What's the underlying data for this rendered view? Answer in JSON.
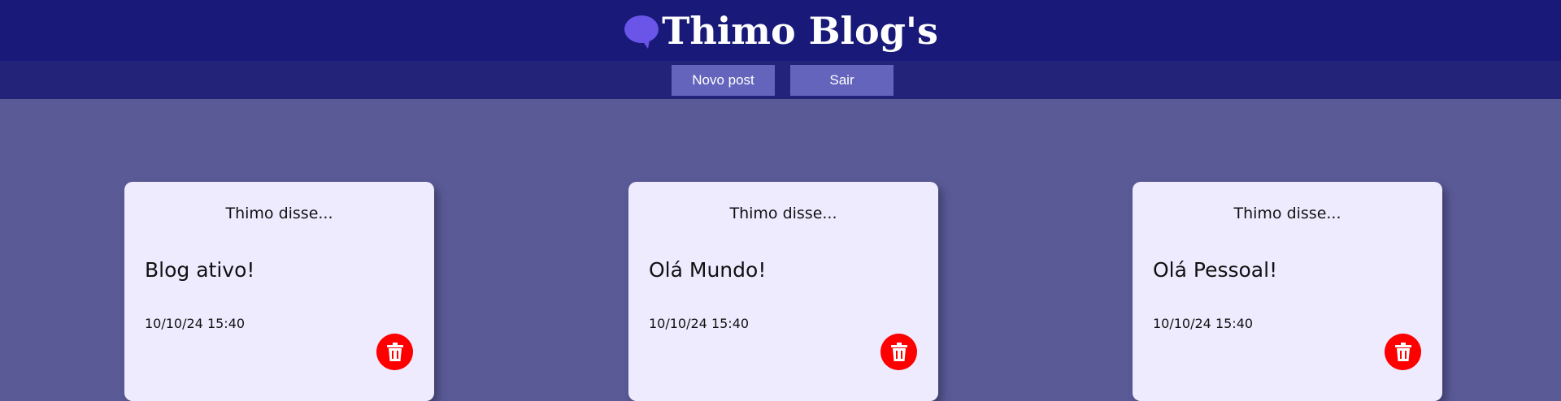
{
  "header": {
    "title": "Thimo Blog's",
    "logo_icon": "speech-bubble-icon",
    "background": "#191979",
    "logo_color": "#6a55e8"
  },
  "nav": {
    "new_post_label": "Novo post",
    "logout_label": "Sair",
    "button_color": "#6464bd"
  },
  "posts": [
    {
      "author": "Thimo disse...",
      "text": "Blog ativo!",
      "date": "10/10/24 15:40"
    },
    {
      "author": "Thimo disse...",
      "text": "Olá Mundo!",
      "date": "10/10/24 15:40"
    },
    {
      "author": "Thimo disse...",
      "text": "Olá Pessoal!",
      "date": "10/10/24 15:40"
    }
  ],
  "delete_icon": "trash-icon",
  "delete_color": "#ff0000"
}
